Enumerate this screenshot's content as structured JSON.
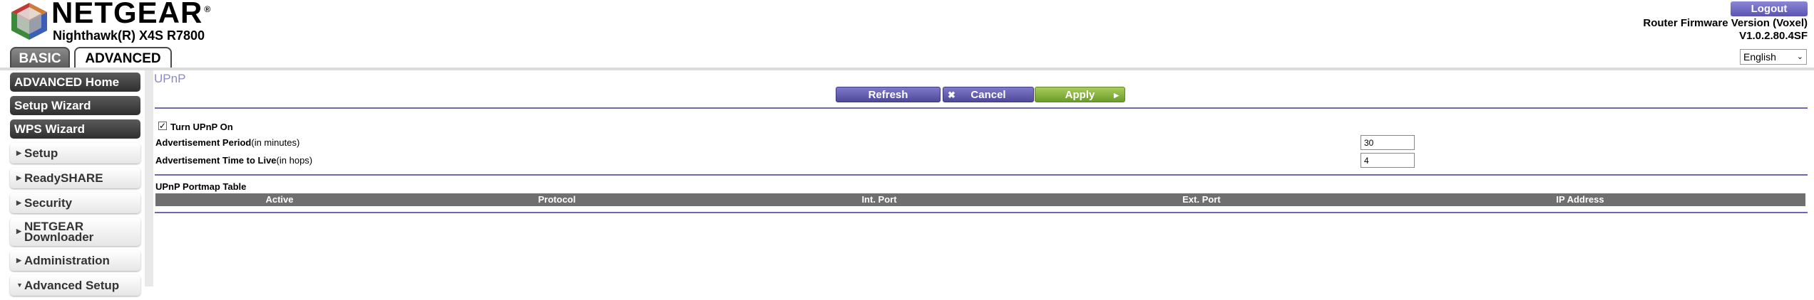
{
  "header": {
    "brand": "NETGEAR",
    "registered_mark": "®",
    "model": "Nighthawk(R) X4S R7800",
    "tabs": [
      {
        "label": "BASIC",
        "active": false
      },
      {
        "label": "ADVANCED",
        "active": true
      }
    ],
    "logout_label": "Logout",
    "firmware_label": "Router Firmware Version (Voxel)",
    "firmware_version": "V1.0.2.80.4SF",
    "language": "English"
  },
  "sidebar": {
    "primary_items": [
      {
        "label": "ADVANCED Home"
      },
      {
        "label": "Setup Wizard"
      },
      {
        "label": "WPS Wizard"
      }
    ],
    "sections": [
      {
        "label": "Setup",
        "expanded": false
      },
      {
        "label": "ReadySHARE",
        "expanded": false
      },
      {
        "label": "Security",
        "expanded": false
      },
      {
        "label": "NETGEAR Downloader",
        "expanded": false
      },
      {
        "label": "Administration",
        "expanded": false
      },
      {
        "label": "Advanced Setup",
        "expanded": true
      }
    ]
  },
  "main": {
    "title": "UPnP",
    "buttons": {
      "refresh": "Refresh",
      "cancel": "Cancel",
      "apply": "Apply"
    },
    "turn_upnp_on": {
      "label": "Turn UPnP On",
      "checked": true
    },
    "advertisement_period": {
      "label": "Advertisement Period",
      "unit": "(in minutes)",
      "value": "30"
    },
    "advertisement_ttl": {
      "label": "Advertisement Time to Live",
      "unit": "(in hops)",
      "value": "4"
    },
    "portmap": {
      "title": "UPnP Portmap Table",
      "columns": [
        "Active",
        "Protocol",
        "Int. Port",
        "Ext. Port",
        "IP Address"
      ],
      "rows": []
    }
  },
  "colors": {
    "accent_purple": "#6c68b5",
    "apply_green": "#8ab440",
    "title_lilac": "#8c88cf"
  }
}
